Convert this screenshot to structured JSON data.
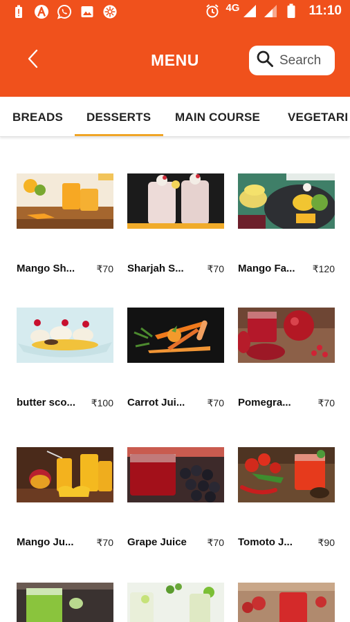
{
  "status_bar": {
    "time": "11:10",
    "network": "4G",
    "left_icons": [
      "battery-alert-icon",
      "app-a-icon",
      "whatsapp-icon",
      "gallery-icon",
      "settings-app-icon"
    ],
    "right_icons": [
      "alarm-icon",
      "signal-icon",
      "signal-icon",
      "battery-icon"
    ]
  },
  "app_bar": {
    "title": "MENU",
    "back_icon": "back-arrow-icon",
    "search": {
      "placeholder": "Search",
      "icon": "search-icon"
    },
    "color": "#f0511c"
  },
  "tabs": {
    "items": [
      "BREADS",
      "DESSERTS",
      "MAIN COURSE",
      "VEGETARI"
    ],
    "selected": "DESSERTS",
    "indicator_color": "#f0a526"
  },
  "menu_items": [
    {
      "name": "Mango Sh...",
      "price": "₹70"
    },
    {
      "name": "Sharjah S...",
      "price": "₹70"
    },
    {
      "name": "Mango Fa...",
      "price": "₹120"
    },
    {
      "name": "butter sco...",
      "price": "₹100"
    },
    {
      "name": "Carrot Jui...",
      "price": "₹70"
    },
    {
      "name": "Pomegra...",
      "price": "₹70"
    },
    {
      "name": "Mango Ju...",
      "price": "₹70"
    },
    {
      "name": "Grape Juice",
      "price": "₹70"
    },
    {
      "name": "Tomoto J...",
      "price": "₹90"
    },
    {
      "name": "",
      "price": ""
    },
    {
      "name": "",
      "price": ""
    },
    {
      "name": "",
      "price": ""
    }
  ]
}
